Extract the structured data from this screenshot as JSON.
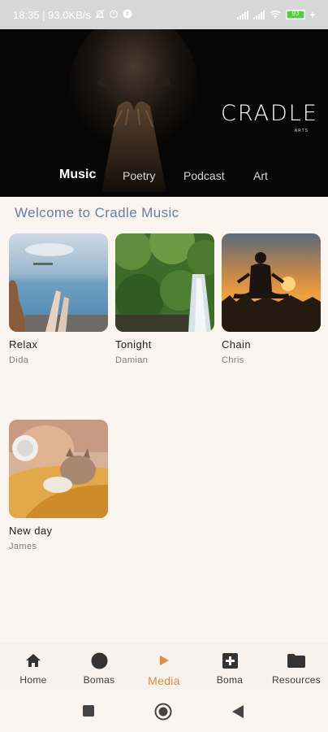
{
  "status_bar": {
    "time_speed": "18:35 | 93.0KB/s",
    "battery": "93"
  },
  "header": {
    "brand": "CRADLE",
    "brand_sub": "ARTS",
    "tabs": [
      {
        "label": "Music",
        "active": true
      },
      {
        "label": "Poetry",
        "active": false
      },
      {
        "label": "Podcast",
        "active": false
      },
      {
        "label": "Art",
        "active": false
      }
    ]
  },
  "welcome": "Welcome to Cradle Music",
  "tracks": [
    {
      "title": "Relax",
      "artist": "Dida"
    },
    {
      "title": "Tonight",
      "artist": "Damian"
    },
    {
      "title": "Chain",
      "artist": "Chris"
    },
    {
      "title": "New day",
      "artist": "James"
    }
  ],
  "bottom_nav": [
    {
      "label": "Home",
      "icon": "home-icon",
      "active": false
    },
    {
      "label": "Bomas",
      "icon": "circle-icon",
      "active": false
    },
    {
      "label": "Media",
      "icon": "play-icon",
      "active": true
    },
    {
      "label": "Boma",
      "icon": "plus-box-icon",
      "active": false
    },
    {
      "label": "Resources",
      "icon": "folder-icon",
      "active": false
    }
  ],
  "colors": {
    "accent": "#e08a3a",
    "welcome": "#6a7fa3",
    "background": "#fbf5ef",
    "header": "#060606"
  }
}
